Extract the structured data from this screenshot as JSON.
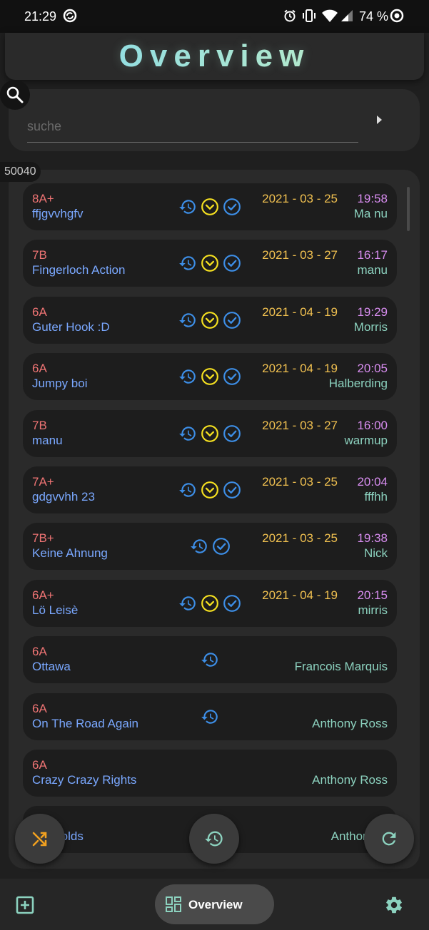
{
  "status_bar": {
    "time": "21:29",
    "battery": "74 %"
  },
  "header": {
    "title": "Overview"
  },
  "search": {
    "placeholder": "suche"
  },
  "result_count": "50040",
  "colors": {
    "grade": "#ef7474",
    "name": "#7aa8ff",
    "date": "#f0c050",
    "time": "#d88df0",
    "user": "#8cd2bf",
    "icon_blue": "#3d8ee6",
    "icon_yellow": "#f5e020"
  },
  "routes": [
    {
      "grade": "8A+",
      "name": "ffjgvvhgfv",
      "date": "2021 - 03 - 25",
      "time": "19:58",
      "user": "Ma nu",
      "icons": [
        "history-icon",
        "chevron-circle-icon",
        "check-circle-icon"
      ]
    },
    {
      "grade": "7B",
      "name": "Fingerloch Action",
      "date": "2021 - 03 - 27",
      "time": "16:17",
      "user": "manu",
      "icons": [
        "history-icon",
        "chevron-circle-icon",
        "check-circle-icon"
      ]
    },
    {
      "grade": "6A",
      "name": "Guter Hook :D",
      "date": "2021 - 04 - 19",
      "time": "19:29",
      "user": "Morris",
      "icons": [
        "history-icon",
        "chevron-circle-icon",
        "check-circle-icon"
      ]
    },
    {
      "grade": "6A",
      "name": "Jumpy boi",
      "date": "2021 - 04 - 19",
      "time": "20:05",
      "user": "Halberding",
      "icons": [
        "history-icon",
        "chevron-circle-icon",
        "check-circle-icon"
      ]
    },
    {
      "grade": "7B",
      "name": "manu",
      "date": "2021 - 03 - 27",
      "time": "16:00",
      "user": "warmup",
      "icons": [
        "history-icon",
        "chevron-circle-icon",
        "check-circle-icon"
      ]
    },
    {
      "grade": "7A+",
      "name": "gdgvvhh 23",
      "date": "2021 - 03 - 25",
      "time": "20:04",
      "user": "fffhh",
      "icons": [
        "history-icon",
        "chevron-circle-icon",
        "check-circle-icon"
      ]
    },
    {
      "grade": "7B+",
      "name": "Keine Ahnung",
      "date": "2021 - 03 - 25",
      "time": "19:38",
      "user": "Nick",
      "icons": [
        "history-icon",
        "check-circle-icon"
      ]
    },
    {
      "grade": "6A+",
      "name": "Lö Leisè",
      "date": "2021 - 04 - 19",
      "time": "20:15",
      "user": "mirris",
      "icons": [
        "history-icon",
        "chevron-circle-icon",
        "check-circle-icon"
      ]
    },
    {
      "grade": "6A",
      "name": "Ottawa",
      "date": "",
      "time": "",
      "user": "Francois Marquis",
      "icons": [
        "history-icon"
      ]
    },
    {
      "grade": "6A",
      "name": "On The Road Again",
      "date": "",
      "time": "",
      "user": "Anthony Ross",
      "icons": [
        "history-icon"
      ]
    },
    {
      "grade": "6A",
      "name": "Crazy Crazy Rights",
      "date": "",
      "time": "",
      "user": "Anthony Ross",
      "icons": []
    },
    {
      "grade": "",
      "name": "ess holds",
      "date": "",
      "time": "",
      "user": "Anthony R",
      "icons": []
    }
  ],
  "fabs": {
    "shuffle": "shuffle-icon",
    "history": "history-icon",
    "refresh": "refresh-icon"
  },
  "bottom_nav": {
    "add": "add-box-icon",
    "overview_label": "Overview",
    "settings": "gear-icon"
  }
}
